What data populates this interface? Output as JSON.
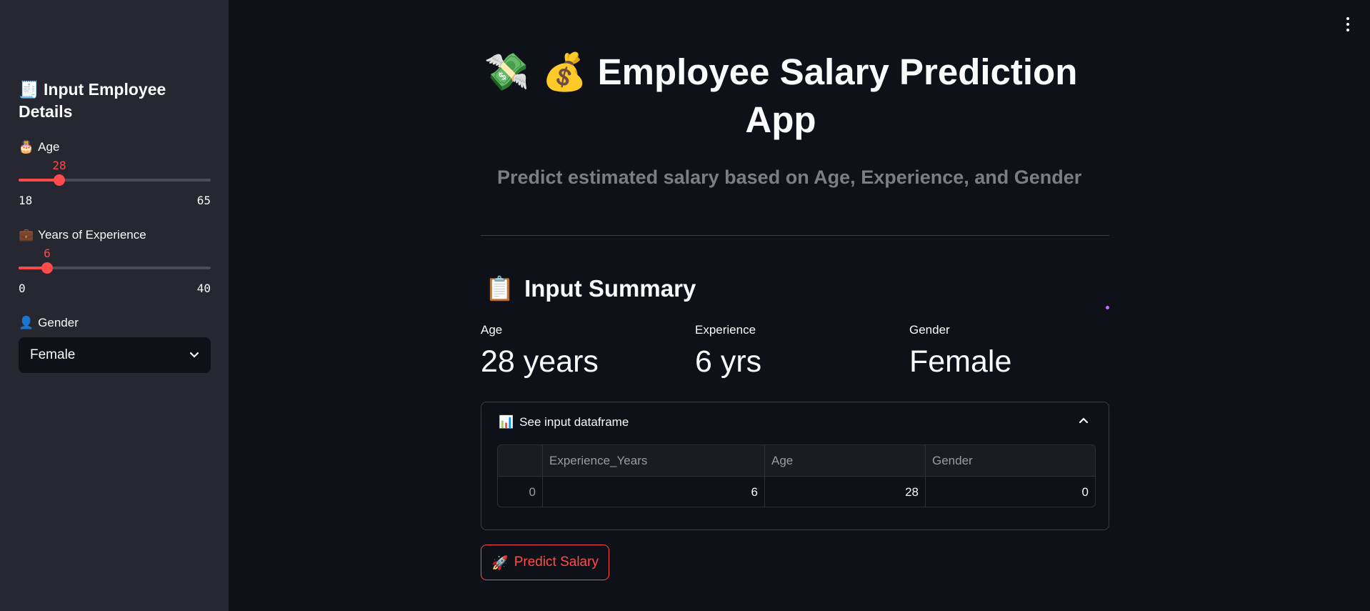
{
  "sidebar": {
    "heading_emoji": "🧾",
    "heading": "Input Employee Details",
    "age": {
      "emoji": "🎂",
      "label": "Age",
      "value": "28",
      "min": "18",
      "max": "65",
      "fraction": 0.2128
    },
    "experience": {
      "emoji": "💼",
      "label": "Years of Experience",
      "value": "6",
      "min": "0",
      "max": "40",
      "fraction": 0.15
    },
    "gender": {
      "emoji": "👤",
      "label": "Gender",
      "selected": "Female"
    }
  },
  "header": {
    "emojis": "💸 💰",
    "title": "Employee Salary Prediction App",
    "subtitle": "Predict estimated salary based on Age, Experience, and Gender"
  },
  "summary": {
    "emoji": "📋",
    "title": "Input Summary",
    "metrics": [
      {
        "label": "Age",
        "value": "28 years"
      },
      {
        "label": "Experience",
        "value": "6 yrs"
      },
      {
        "label": "Gender",
        "value": "Female"
      }
    ]
  },
  "expander": {
    "emoji": "📊",
    "label": "See input dataframe",
    "columns": [
      "",
      "Experience_Years",
      "Age",
      "Gender"
    ],
    "row": [
      "0",
      "6",
      "28",
      "0"
    ]
  },
  "predict_button": {
    "emoji": "🚀",
    "label": "Predict Salary"
  },
  "colors": {
    "accent": "#ff4b4b",
    "background": "#0e1117",
    "sidebar": "#262730"
  }
}
